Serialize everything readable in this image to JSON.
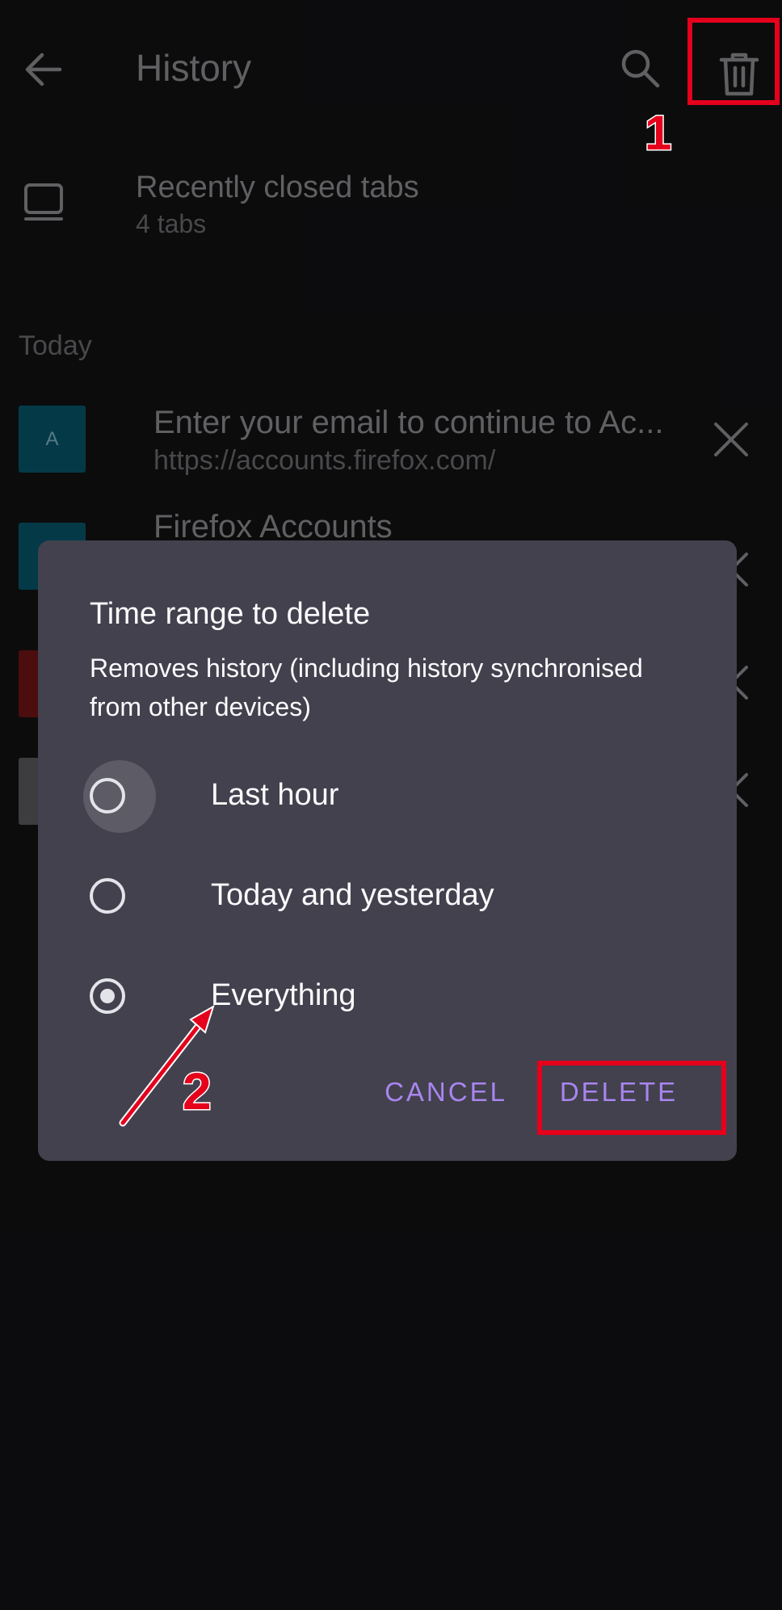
{
  "topbar": {
    "title": "History",
    "back_icon": "arrow-left-icon",
    "search_icon": "search-icon",
    "delete_icon": "trash-icon"
  },
  "recently_closed": {
    "title": "Recently closed tabs",
    "subtitle": "4 tabs"
  },
  "sections": {
    "today": "Today"
  },
  "history_items": [
    {
      "favicon_letter": "A",
      "favicon_color": "#07566b",
      "title": "Enter your email to continue to Ac...",
      "url": "https://accounts.firefox.com/"
    },
    {
      "favicon_letter": "",
      "favicon_color": "#07566b",
      "title": "Firefox Accounts",
      "url": ""
    },
    {
      "favicon_letter": "",
      "favicon_color": "#6f1414",
      "title": "",
      "url": ""
    },
    {
      "favicon_letter": "",
      "favicon_color": "#5a5a5e",
      "title": "",
      "url": ""
    }
  ],
  "dialog": {
    "title": "Time range to delete",
    "description": "Removes history (including history synchronised from other devices)",
    "options": [
      {
        "label": "Last hour",
        "selected": false
      },
      {
        "label": "Today and yesterday",
        "selected": false
      },
      {
        "label": "Everything",
        "selected": true
      }
    ],
    "cancel_label": "CANCEL",
    "delete_label": "DELETE"
  },
  "annotations": {
    "step1": "1",
    "step2": "2",
    "color": "#e5001c"
  },
  "colors": {
    "background": "#121214",
    "dialog_bg": "#42414d",
    "accent": "#a985f0"
  }
}
